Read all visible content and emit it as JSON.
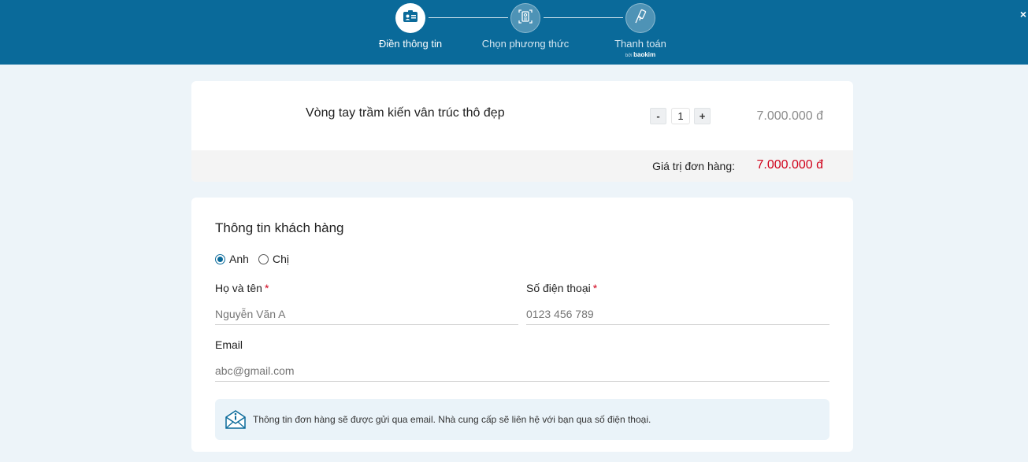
{
  "header": {
    "close_label": "×",
    "steps": [
      {
        "label": "Điền thông tin",
        "icon": "id-card-icon",
        "active": true
      },
      {
        "label": "Chọn phương thức",
        "icon": "document-select-icon",
        "active": false
      },
      {
        "label": "Thanh toán",
        "icon": "payment-hand-icon",
        "active": false,
        "sub_prefix": "bởi",
        "sub_brand": "baokim"
      }
    ]
  },
  "product": {
    "name": "Vòng tay trầm kiến vân trúc thô đẹp",
    "qty_minus": "-",
    "quantity": "1",
    "qty_plus": "+",
    "price": "7.000.000 đ",
    "total_label": "Giá trị đơn hàng:",
    "total_value": "7.000.000 đ"
  },
  "form": {
    "title": "Thông tin khách hàng",
    "gender_options": [
      "Anh",
      "Chị"
    ],
    "gender_selected": "Anh",
    "name_label": "Họ và tên",
    "name_required": "*",
    "name_placeholder": "Nguyễn Văn A",
    "phone_label": "Số điện thoại",
    "phone_required": "*",
    "phone_placeholder": "0123 456 789",
    "email_label": "Email",
    "email_placeholder": "abc@gmail.com",
    "notice_icon": "mail-info-icon",
    "notice": "Thông tin đơn hàng sẽ được gửi qua email. Nhà cung cấp sẽ liên hệ với bạn qua số điện thoại."
  },
  "colors": {
    "header_bg": "#0a6a9a",
    "page_bg": "#edf4f9",
    "accent_red": "#d0021b",
    "notice_bg": "#eaf3f9"
  }
}
